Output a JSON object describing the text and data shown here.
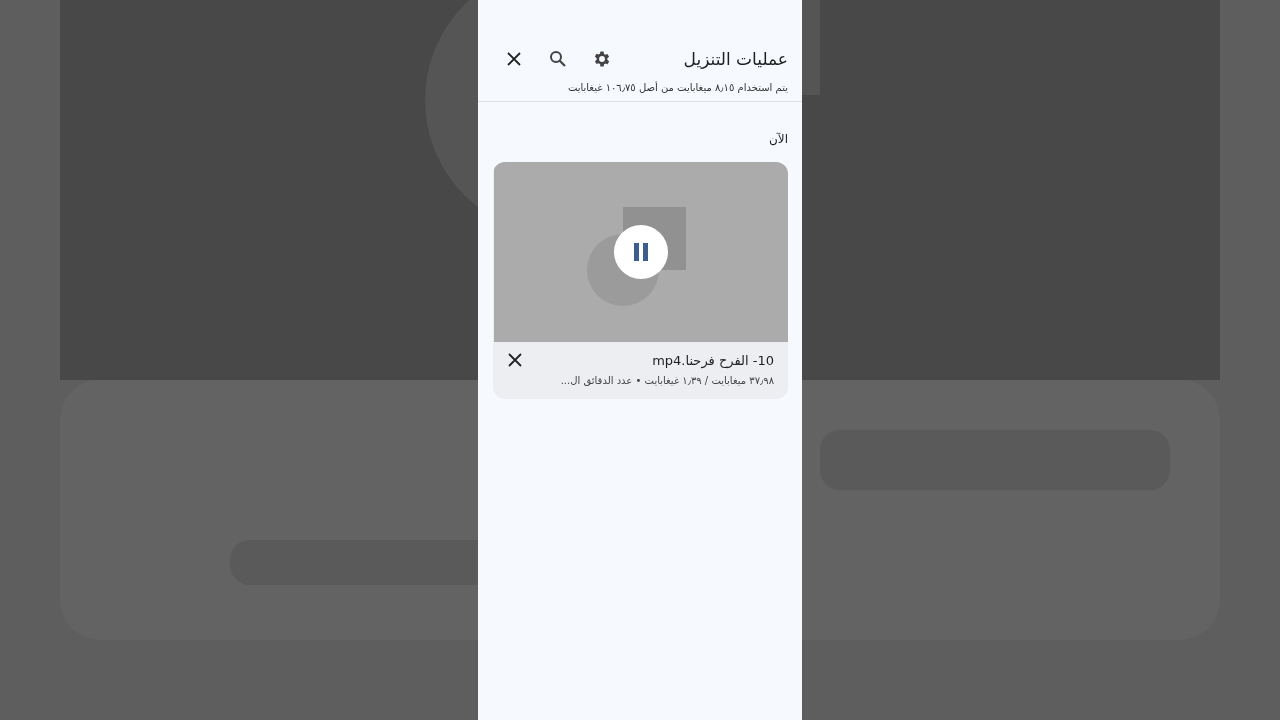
{
  "header": {
    "title": "عمليات التنزيل",
    "storage": "يتم استخدام ٨٫١٥ ميغابايت من أصل ١٠٦٫٧٥ غيغابايت"
  },
  "section": {
    "title": "الآن"
  },
  "downloads": [
    {
      "name": "10- الفرح فرحنا.mp4",
      "details": "٣٧٫٩٨ ميغابايت / ١٫٣٩ غيغابايت • عدد الدقائق ال...",
      "paused": false
    }
  ]
}
